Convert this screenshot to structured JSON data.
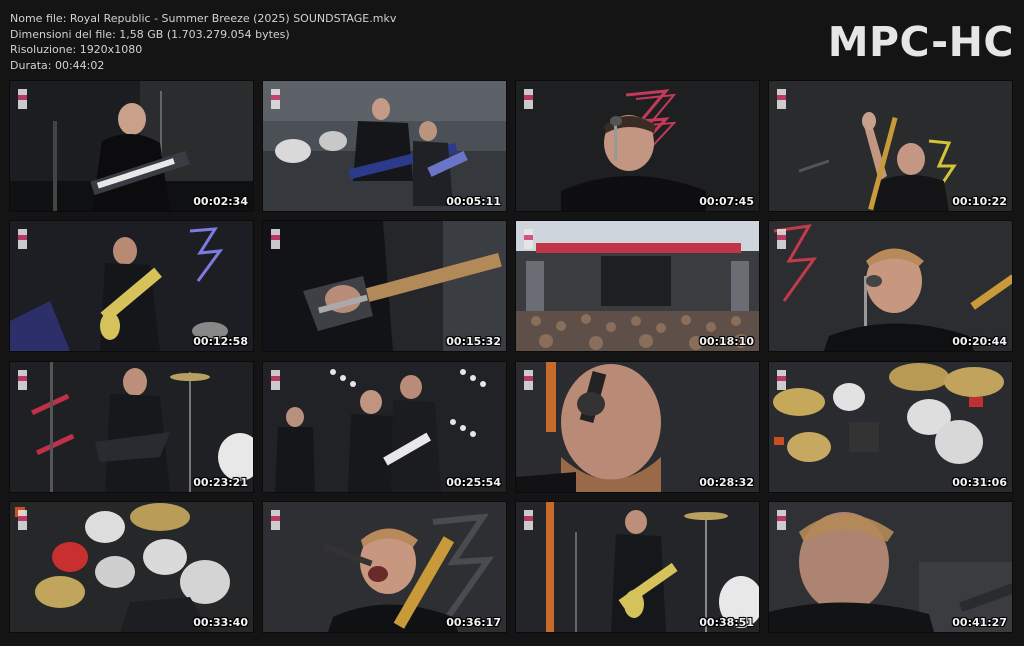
{
  "file_info": {
    "filename_line": "Nome file: Royal Republic - Summer Breeze (2025) SOUNDSTAGE.mkv",
    "size_line": "Dimensioni del file: 1,58 GB (1.703.279.054 bytes)",
    "resolution_line": "Risoluzione: 1920x1080",
    "duration_line": "Durata: 00:44:02"
  },
  "brand": "MPC-HC",
  "thumbnails": [
    {
      "time": "00:02:34",
      "scene": "keytar-singer"
    },
    {
      "time": "00:05:11",
      "scene": "crowd-guitarists"
    },
    {
      "time": "00:07:45",
      "scene": "singer-closeup"
    },
    {
      "time": "00:10:22",
      "scene": "bassist-arms-raised"
    },
    {
      "time": "00:12:58",
      "scene": "singer-guitar-stage"
    },
    {
      "time": "00:15:32",
      "scene": "guitar-closeup"
    },
    {
      "time": "00:18:10",
      "scene": "festival-crowd-wide"
    },
    {
      "time": "00:20:44",
      "scene": "bassist-singing"
    },
    {
      "time": "00:23:21",
      "scene": "singer-flying-v"
    },
    {
      "time": "00:25:54",
      "scene": "band-lights"
    },
    {
      "time": "00:28:32",
      "scene": "bassist-mic-closeup"
    },
    {
      "time": "00:31:06",
      "scene": "drum-kit-overhead"
    },
    {
      "time": "00:33:40",
      "scene": "drummer-overhead"
    },
    {
      "time": "00:36:17",
      "scene": "bassist-shouting"
    },
    {
      "time": "00:38:51",
      "scene": "singer-white-guitar"
    },
    {
      "time": "00:41:27",
      "scene": "bassist-motion-blur"
    }
  ]
}
